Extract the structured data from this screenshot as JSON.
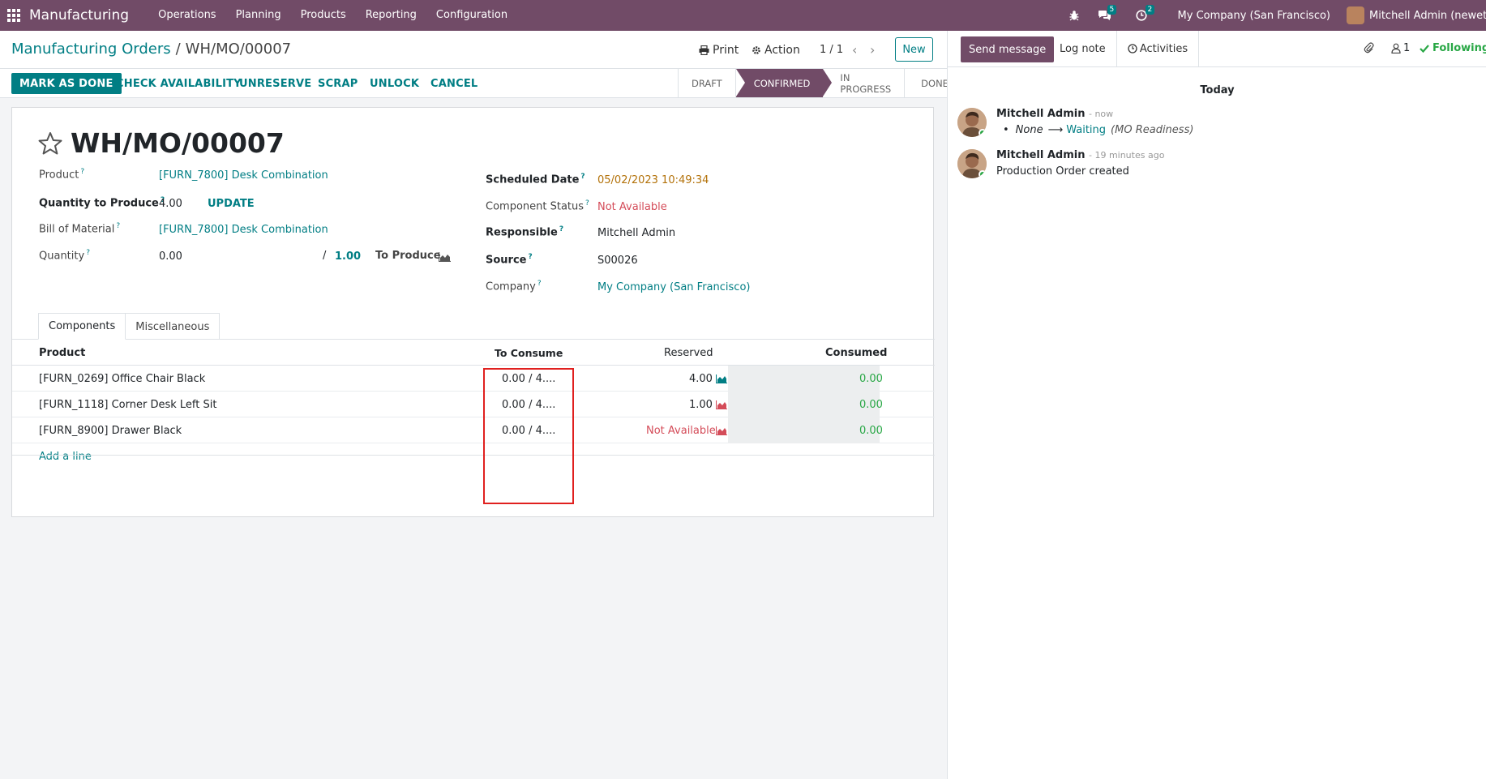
{
  "navbar": {
    "app_name": "Manufacturing",
    "menu": [
      "Operations",
      "Planning",
      "Products",
      "Reporting",
      "Configuration"
    ],
    "messages_count": "5",
    "activities_count": "2",
    "company": "My Company (San Francisco)",
    "user": "Mitchell Admin (neweter"
  },
  "control": {
    "breadcrumb_parent": "Manufacturing Orders",
    "breadcrumb_sep": "/",
    "breadcrumb_current": "WH/MO/00007",
    "print_label": "Print",
    "action_label": "Action",
    "pager": "1 / 1",
    "new_label": "New"
  },
  "statusbar": {
    "buttons": [
      "MARK AS DONE",
      "CHECK AVAILABILITY",
      "UNRESERVE",
      "SCRAP",
      "UNLOCK",
      "CANCEL"
    ],
    "stages": [
      "DRAFT",
      "CONFIRMED",
      "IN PROGRESS",
      "DONE"
    ],
    "active_stage": "CONFIRMED"
  },
  "form": {
    "title": "WH/MO/00007",
    "product_label": "Product",
    "product_value": "[FURN_7800] Desk Combination",
    "qty_produce_label": "Quantity to Produce",
    "qty_produce_value": "4.00",
    "update_label": "UPDATE",
    "bom_label": "Bill of Material",
    "bom_value": "[FURN_7800] Desk Combination",
    "quantity_label": "Quantity",
    "quantity_value": "0.00",
    "quantity_sep": "/",
    "quantity_total": "1.00",
    "to_produce_label": "To Produce",
    "scheduled_label": "Scheduled Date",
    "scheduled_value": "05/02/2023 10:49:34",
    "component_status_label": "Component Status",
    "component_status_value": "Not Available",
    "responsible_label": "Responsible",
    "responsible_value": "Mitchell Admin",
    "source_label": "Source",
    "source_value": "S00026",
    "company_label": "Company",
    "company_value": "My Company (San Francisco)",
    "help_mark": "?"
  },
  "tabs": [
    "Components",
    "Miscellaneous"
  ],
  "table": {
    "headers": [
      "Product",
      "To Consume",
      "Reserved",
      "Consumed"
    ],
    "rows": [
      {
        "product": "[FURN_0269] Office Chair Black",
        "to_consume": "0.00 /  4....",
        "reserved": "4.00",
        "reserved_color": "#017e84",
        "consumed": "0.00"
      },
      {
        "product": "[FURN_1118] Corner Desk Left Sit",
        "to_consume": "0.00 /  4....",
        "reserved": "1.00",
        "reserved_color": "#d44c59",
        "consumed": "0.00"
      },
      {
        "product": "[FURN_8900] Drawer Black",
        "to_consume": "0.00 /  4....",
        "reserved": "Not Available",
        "reserved_color": "#d44c59",
        "consumed": "0.00"
      }
    ],
    "add_line": "Add a line"
  },
  "chatter": {
    "send_message": "Send message",
    "log_note": "Log note",
    "activities": "Activities",
    "followers_count": "1",
    "following": "Following",
    "today": "Today",
    "messages": [
      {
        "author": "Mitchell Admin",
        "time": "- now",
        "old_value": "None",
        "arrow": "⟶",
        "new_value": "Waiting",
        "field": "(MO Readiness)"
      },
      {
        "author": "Mitchell Admin",
        "time": "- 19 minutes ago",
        "body": "Production Order created"
      }
    ]
  },
  "colors": {
    "brand": "#714B67",
    "accent": "#017e84",
    "danger": "#d44c59",
    "success": "#28a745"
  }
}
